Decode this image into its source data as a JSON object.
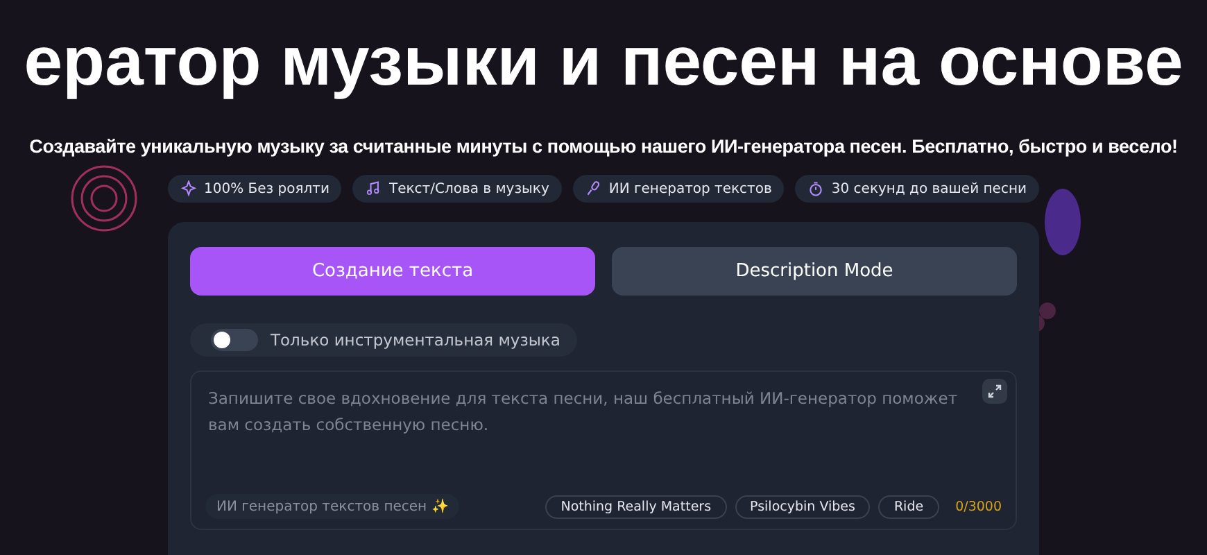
{
  "hero": {
    "title": "ератор музыки и песен на основе",
    "subtitle": "Создавайте уникальную музыку за считанные минуты с помощью нашего ИИ-генератора песен. Бесплатно, быстро и весело!"
  },
  "features": [
    {
      "kind": "sparkle",
      "label": "100% Без роялти"
    },
    {
      "kind": "note",
      "label": "Текст/Слова в музыку"
    },
    {
      "kind": "mic",
      "label": "ИИ генератор текстов"
    },
    {
      "kind": "timer",
      "label": "30 секунд до вашей песни"
    }
  ],
  "tabs": [
    {
      "label": "Создание текста",
      "selected": true
    },
    {
      "label": "Description Mode",
      "selected": false
    }
  ],
  "instrumental": {
    "label": "Только инструментальная музыка",
    "on": false
  },
  "lyrics": {
    "placeholder": "Запишите свое вдохновение для текста песни, наш бесплатный ИИ-генератор поможет вам создать собственную песню.",
    "generator_chip": "ИИ генератор текстов песен ✨",
    "suggestions": [
      "Nothing Really Matters",
      "Psilocybin Vibes",
      "Ride"
    ],
    "counter": "0/3000"
  }
}
